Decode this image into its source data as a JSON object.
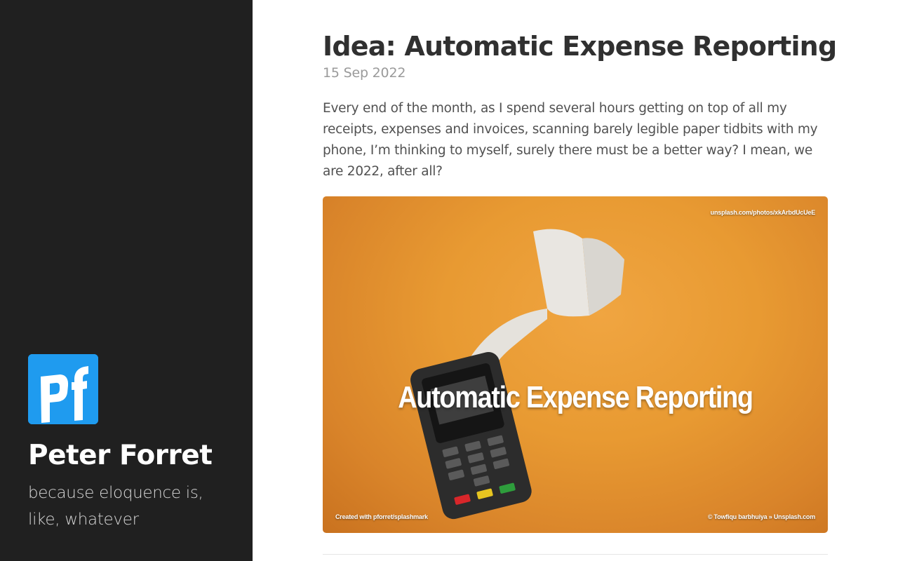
{
  "sidebar": {
    "logo_icon": "pf-logo",
    "site_name": "Peter Forret",
    "tagline": "because eloquence is, like, whatever",
    "background_color": "#202020",
    "logo_color": "#1f9bef"
  },
  "post": {
    "title": "Idea: Automatic Expense Reporting",
    "date": "15 Sep 2022",
    "excerpt": "Every end of the month, as I spend several hours getting on top of all my receipts, expenses and invoices, scanning barely legible paper tidbits with my phone, I’m thinking to myself, surely there must be a better way? I mean, we are 2022, after all?",
    "image": {
      "caption": "Automatic Expense Reporting",
      "source": "unsplash.com/photos/xkArbdUcUeE",
      "credit_left": "Created with pforret/splashmark",
      "credit_right": "© Towfiqu barbhuiya » Unsplash.com",
      "background_color": "#e89a32"
    }
  }
}
